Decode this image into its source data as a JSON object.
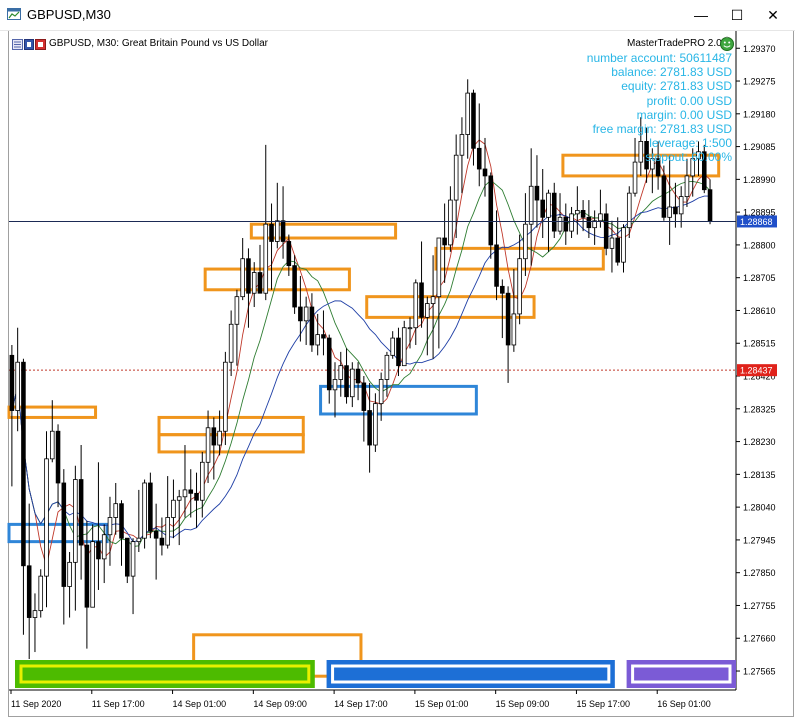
{
  "window": {
    "title": "GBPUSD,M30",
    "minimize_glyph": "—",
    "maximize_glyph": "☐",
    "close_glyph": "✕"
  },
  "chart_header": {
    "symbol": "GBPUSD, M30:",
    "description": "Great Britain Pound vs US Dollar",
    "expert_name": "MasterTradePRO 2.0",
    "expert_icon": "smiley-expert-icon"
  },
  "account": {
    "number_account": "number account: 50611487",
    "balance": "balance: 2781.83 USD",
    "equity": "equity: 2781.83 USD",
    "profit": "profit: 0.00 USD",
    "margin": "margin: 0.00 USD",
    "free_margin": "free margin: 2781.83 USD",
    "leverage": "leverage: 1:500",
    "stopout": "stopout: 60.00%"
  },
  "colors": {
    "zone_orange": "#f0951c",
    "zone_blue": "#2f86d8",
    "green_bar": "#4dbb00",
    "blue_bar": "#1d6fd6",
    "purple_bar": "#7b5bd6",
    "info_text": "#29b6e6",
    "current_price_bg": "#1f4fc9",
    "reference_price_bg": "#e0221b"
  },
  "chart_data": {
    "type": "candlestick",
    "symbol": "GBPUSD",
    "timeframe": "M30",
    "ylim": [
      1.2751,
      1.2942
    ],
    "y_ticks": [
      "1.29370",
      "1.29275",
      "1.29180",
      "1.29085",
      "1.28990",
      "1.28895",
      "1.28800",
      "1.28705",
      "1.28610",
      "1.28515",
      "1.28420",
      "1.28325",
      "1.28230",
      "1.28135",
      "1.28040",
      "1.27945",
      "1.27850",
      "1.27755",
      "1.27660",
      "1.27565"
    ],
    "x_ticks": [
      "11 Sep 2020",
      "11 Sep 17:00",
      "14 Sep 01:00",
      "14 Sep 09:00",
      "14 Sep 17:00",
      "15 Sep 01:00",
      "15 Sep 09:00",
      "15 Sep 17:00",
      "16 Sep 01:00"
    ],
    "current_price_label": "1.28868",
    "current_price": 1.28868,
    "reference_price_label": "1.28437",
    "reference_price": 1.28437,
    "bar_count": 126,
    "candles": [
      [
        1.2848,
        1.2851,
        1.281,
        1.2832
      ],
      [
        1.2832,
        1.2856,
        1.2826,
        1.2846
      ],
      [
        1.2846,
        1.2847,
        1.2767,
        1.2787
      ],
      [
        1.2787,
        1.2805,
        1.276,
        1.2772
      ],
      [
        1.2772,
        1.2779,
        1.2762,
        1.2774
      ],
      [
        1.2774,
        1.2786,
        1.2772,
        1.2784
      ],
      [
        1.2784,
        1.2826,
        1.2775,
        1.2818
      ],
      [
        1.2818,
        1.2835,
        1.2817,
        1.2826
      ],
      [
        1.2826,
        1.2828,
        1.2804,
        1.2811
      ],
      [
        1.2811,
        1.2815,
        1.277,
        1.2781
      ],
      [
        1.2781,
        1.2791,
        1.2772,
        1.2788
      ],
      [
        1.2788,
        1.2816,
        1.2774,
        1.2812
      ],
      [
        1.2812,
        1.2822,
        1.2783,
        1.2793
      ],
      [
        1.2793,
        1.28,
        1.2763,
        1.2775
      ],
      [
        1.2775,
        1.2799,
        1.2775,
        1.2794
      ],
      [
        1.2794,
        1.2817,
        1.278,
        1.2789
      ],
      [
        1.2789,
        1.2799,
        1.2782,
        1.2796
      ],
      [
        1.2796,
        1.2807,
        1.2787,
        1.2801
      ],
      [
        1.2801,
        1.2811,
        1.2796,
        1.2805
      ],
      [
        1.2805,
        1.2806,
        1.2787,
        1.2795
      ],
      [
        1.2795,
        1.2795,
        1.2782,
        1.2784
      ],
      [
        1.2784,
        1.2795,
        1.2773,
        1.2794
      ],
      [
        1.2794,
        1.2809,
        1.2791,
        1.2795
      ],
      [
        1.2795,
        1.2812,
        1.2792,
        1.2811
      ],
      [
        1.2811,
        1.2814,
        1.2795,
        1.2797
      ],
      [
        1.2797,
        1.2805,
        1.2783,
        1.2795
      ],
      [
        1.2795,
        1.2801,
        1.279,
        1.2793
      ],
      [
        1.2793,
        1.2813,
        1.2792,
        1.2801
      ],
      [
        1.2801,
        1.2812,
        1.2795,
        1.2806
      ],
      [
        1.2806,
        1.2809,
        1.2793,
        1.2807
      ],
      [
        1.2807,
        1.2822,
        1.2801,
        1.2809
      ],
      [
        1.2809,
        1.2815,
        1.2801,
        1.2808
      ],
      [
        1.2808,
        1.2814,
        1.2798,
        1.2806
      ],
      [
        1.2806,
        1.282,
        1.2801,
        1.2817
      ],
      [
        1.2817,
        1.2832,
        1.2811,
        1.2827
      ],
      [
        1.2827,
        1.283,
        1.2812,
        1.2822
      ],
      [
        1.2822,
        1.2832,
        1.2819,
        1.2826
      ],
      [
        1.2826,
        1.2849,
        1.2822,
        1.2846
      ],
      [
        1.2846,
        1.2861,
        1.2842,
        1.2857
      ],
      [
        1.2857,
        1.2867,
        1.2845,
        1.2865
      ],
      [
        1.2865,
        1.2882,
        1.2864,
        1.2876
      ],
      [
        1.2876,
        1.2879,
        1.2856,
        1.2866
      ],
      [
        1.2866,
        1.2875,
        1.2862,
        1.2872
      ],
      [
        1.2872,
        1.288,
        1.2866,
        1.2866
      ],
      [
        1.2866,
        1.2909,
        1.2864,
        1.2886
      ],
      [
        1.2886,
        1.2892,
        1.2867,
        1.2881
      ],
      [
        1.2881,
        1.2898,
        1.2879,
        1.2887
      ],
      [
        1.2887,
        1.2897,
        1.2876,
        1.2881
      ],
      [
        1.2881,
        1.2883,
        1.2871,
        1.2874
      ],
      [
        1.2874,
        1.2877,
        1.286,
        1.2862
      ],
      [
        1.2862,
        1.2871,
        1.2852,
        1.2858
      ],
      [
        1.2858,
        1.2865,
        1.2851,
        1.2862
      ],
      [
        1.2862,
        1.2866,
        1.2849,
        1.2851
      ],
      [
        1.2851,
        1.286,
        1.2848,
        1.2854
      ],
      [
        1.2854,
        1.2861,
        1.2848,
        1.2853
      ],
      [
        1.2853,
        1.2854,
        1.2834,
        1.2838
      ],
      [
        1.2838,
        1.2846,
        1.283,
        1.2841
      ],
      [
        1.2841,
        1.2849,
        1.2836,
        1.2845
      ],
      [
        1.2845,
        1.285,
        1.2834,
        1.2836
      ],
      [
        1.2836,
        1.2846,
        1.2833,
        1.2844
      ],
      [
        1.2844,
        1.2846,
        1.2835,
        1.284
      ],
      [
        1.284,
        1.2842,
        1.2823,
        1.2832
      ],
      [
        1.2832,
        1.284,
        1.2814,
        1.2822
      ],
      [
        1.2822,
        1.2837,
        1.282,
        1.2834
      ],
      [
        1.2834,
        1.2843,
        1.2829,
        1.2841
      ],
      [
        1.2841,
        1.2849,
        1.2836,
        1.2848
      ],
      [
        1.2848,
        1.2855,
        1.2847,
        1.2853
      ],
      [
        1.2853,
        1.2856,
        1.2842,
        1.2845
      ],
      [
        1.2845,
        1.2858,
        1.2845,
        1.2856
      ],
      [
        1.2856,
        1.2859,
        1.285,
        1.2856
      ],
      [
        1.2856,
        1.287,
        1.2851,
        1.2869
      ],
      [
        1.2869,
        1.2881,
        1.2856,
        1.2859
      ],
      [
        1.2859,
        1.2865,
        1.2848,
        1.2863
      ],
      [
        1.2863,
        1.2877,
        1.2847,
        1.2865
      ],
      [
        1.2865,
        1.2882,
        1.285,
        1.2882
      ],
      [
        1.2882,
        1.2892,
        1.2869,
        1.288
      ],
      [
        1.288,
        1.2897,
        1.2878,
        1.2893
      ],
      [
        1.2893,
        1.2912,
        1.2882,
        1.2906
      ],
      [
        1.2906,
        1.2917,
        1.2895,
        1.2912
      ],
      [
        1.2912,
        1.2928,
        1.2905,
        1.2924
      ],
      [
        1.2924,
        1.2925,
        1.2903,
        1.2908
      ],
      [
        1.2908,
        1.2921,
        1.2897,
        1.2902
      ],
      [
        1.2902,
        1.2911,
        1.2894,
        1.29
      ],
      [
        1.29,
        1.2901,
        1.2876,
        1.288
      ],
      [
        1.288,
        1.289,
        1.2864,
        1.2868
      ],
      [
        1.2868,
        1.287,
        1.2853,
        1.2866
      ],
      [
        1.2866,
        1.2868,
        1.284,
        1.2851
      ],
      [
        1.2851,
        1.2873,
        1.2849,
        1.286
      ],
      [
        1.286,
        1.2883,
        1.2857,
        1.2876
      ],
      [
        1.2876,
        1.2895,
        1.2871,
        1.2886
      ],
      [
        1.2886,
        1.2908,
        1.2874,
        1.2897
      ],
      [
        1.2897,
        1.2906,
        1.2885,
        1.2893
      ],
      [
        1.2893,
        1.2902,
        1.2882,
        1.2888
      ],
      [
        1.2888,
        1.2896,
        1.2878,
        1.2895
      ],
      [
        1.2895,
        1.2898,
        1.2882,
        1.2884
      ],
      [
        1.2884,
        1.2895,
        1.2883,
        1.2888
      ],
      [
        1.2888,
        1.2892,
        1.288,
        1.2884
      ],
      [
        1.2884,
        1.2891,
        1.2882,
        1.2889
      ],
      [
        1.2889,
        1.2897,
        1.2883,
        1.289
      ],
      [
        1.289,
        1.2893,
        1.2884,
        1.2888
      ],
      [
        1.2888,
        1.2893,
        1.2882,
        1.2885
      ],
      [
        1.2885,
        1.289,
        1.288,
        1.2887
      ],
      [
        1.2887,
        1.2896,
        1.2885,
        1.2889
      ],
      [
        1.2889,
        1.2892,
        1.2877,
        1.2879
      ],
      [
        1.2879,
        1.2887,
        1.2872,
        1.2882
      ],
      [
        1.2882,
        1.2888,
        1.2874,
        1.2875
      ],
      [
        1.2875,
        1.2886,
        1.2872,
        1.2885
      ],
      [
        1.2885,
        1.2897,
        1.2882,
        1.2895
      ],
      [
        1.2895,
        1.2911,
        1.2894,
        1.2904
      ],
      [
        1.2904,
        1.2917,
        1.29,
        1.291
      ],
      [
        1.291,
        1.2914,
        1.2898,
        1.2902
      ],
      [
        1.2902,
        1.2908,
        1.2895,
        1.2905
      ],
      [
        1.2905,
        1.291,
        1.2896,
        1.29
      ],
      [
        1.29,
        1.2903,
        1.2887,
        1.2888
      ],
      [
        1.2888,
        1.2906,
        1.288,
        1.2891
      ],
      [
        1.2891,
        1.2898,
        1.2885,
        1.2889
      ],
      [
        1.2889,
        1.2897,
        1.2885,
        1.2894
      ],
      [
        1.2894,
        1.2905,
        1.2891,
        1.29
      ],
      [
        1.29,
        1.2908,
        1.2894,
        1.2905
      ],
      [
        1.2905,
        1.291,
        1.29,
        1.2907
      ],
      [
        1.2907,
        1.2909,
        1.2895,
        1.2896
      ],
      [
        1.2896,
        1.2899,
        1.2886,
        1.2887
      ]
    ],
    "zones_orange": [
      {
        "x": [
          0,
          14
        ],
        "y": [
          1.283,
          1.2833
        ]
      },
      {
        "x": [
          26,
          50
        ],
        "y": [
          1.2825,
          1.283
        ]
      },
      {
        "x": [
          26,
          50
        ],
        "y": [
          1.282,
          1.2825
        ]
      },
      {
        "x": [
          34,
          58
        ],
        "y": [
          1.2867,
          1.2873
        ]
      },
      {
        "x": [
          42,
          66
        ],
        "y": [
          1.2882,
          1.2886
        ]
      },
      {
        "x": [
          32,
          60
        ],
        "y": [
          1.2755,
          1.2767
        ]
      },
      {
        "x": [
          74,
          102
        ],
        "y": [
          1.2873,
          1.2879
        ]
      },
      {
        "x": [
          62,
          90
        ],
        "y": [
          1.2859,
          1.2865
        ]
      },
      {
        "x": [
          96,
          122
        ],
        "y": [
          1.29,
          1.2906
        ]
      }
    ],
    "zones_blue": [
      {
        "x": [
          0,
          16
        ],
        "y": [
          1.2794,
          1.2799
        ]
      },
      {
        "x": [
          54,
          80
        ],
        "y": [
          1.2831,
          1.2839
        ]
      }
    ],
    "status_bars": [
      {
        "name": "green",
        "x": [
          0,
          52
        ]
      },
      {
        "name": "blue",
        "x": [
          54,
          104
        ]
      },
      {
        "name": "purple",
        "x": [
          106,
          126
        ]
      }
    ]
  }
}
